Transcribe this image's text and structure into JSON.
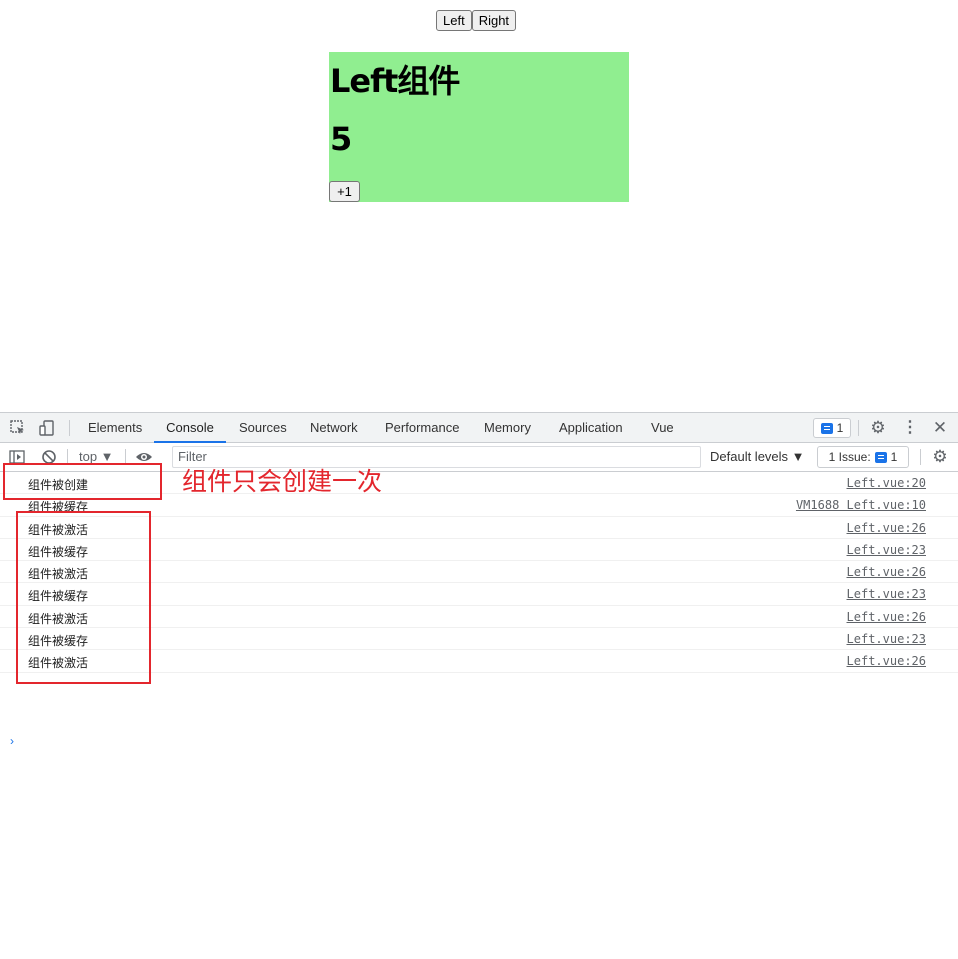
{
  "page": {
    "nav": {
      "left_label": "Left",
      "right_label": "Right"
    },
    "left_component": {
      "title": "Left组件",
      "count": "5",
      "increment_label": "+1"
    }
  },
  "devtools": {
    "tabs": [
      "Elements",
      "Console",
      "Sources",
      "Network",
      "Performance",
      "Memory",
      "Application",
      "Vue"
    ],
    "active_tab": "Console",
    "messages_count": "1",
    "context": "top ▼",
    "filter_placeholder": "Filter",
    "levels_label": "Default levels ▼",
    "issues_label": "1 Issue:",
    "issues_count": "1",
    "logs": [
      {
        "message": "组件被创建",
        "source": "Left.vue:20"
      },
      {
        "message": "组件被缓存",
        "source": "VM1688 Left.vue:10"
      },
      {
        "message": "组件被激活",
        "source": "Left.vue:26"
      },
      {
        "message": "组件被缓存",
        "source": "Left.vue:23"
      },
      {
        "message": "组件被激活",
        "source": "Left.vue:26"
      },
      {
        "message": "组件被缓存",
        "source": "Left.vue:23"
      },
      {
        "message": "组件被激活",
        "source": "Left.vue:26"
      },
      {
        "message": "组件被缓存",
        "source": "Left.vue:23"
      },
      {
        "message": "组件被激活",
        "source": "Left.vue:26"
      }
    ],
    "prompt": "›"
  },
  "annotation": {
    "text": "组件只会创建一次",
    "color": "#e3262d"
  },
  "colors": {
    "panel_bg": "#90ee90",
    "accent": "#1a73e8"
  }
}
